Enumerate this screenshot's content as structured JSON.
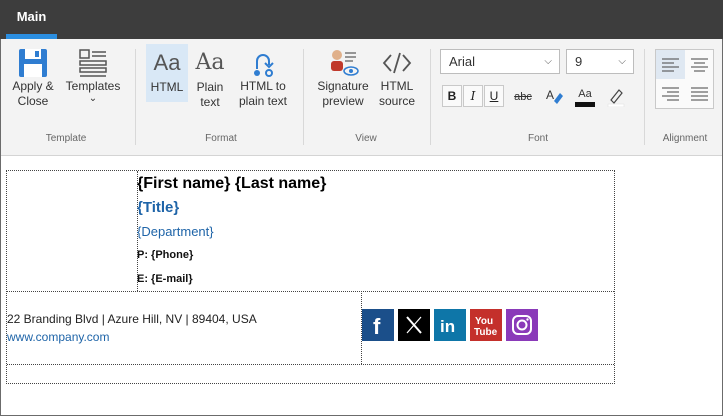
{
  "tabs": [
    {
      "label": "Main",
      "active": true
    }
  ],
  "ribbon": {
    "template_group": {
      "label": "Template",
      "buttons": [
        {
          "label_line1": "Apply &",
          "label_line2": "Close",
          "icon": "save-icon"
        },
        {
          "label_line1": "Templates",
          "label_line2": "⌄",
          "icon": "templates-icon"
        }
      ]
    },
    "format_group": {
      "label": "Format",
      "buttons": [
        {
          "label_line1": "HTML",
          "label_line2": "",
          "icon": "html-format-icon",
          "active": true
        },
        {
          "label_line1": "Plain",
          "label_line2": "text",
          "icon": "plain-text-icon"
        },
        {
          "label_line1": "HTML to",
          "label_line2": "plain text",
          "icon": "convert-icon"
        }
      ]
    },
    "view_group": {
      "label": "View",
      "buttons": [
        {
          "label_line1": "Signature",
          "label_line2": "preview",
          "icon": "signature-preview-icon"
        },
        {
          "label_line1": "HTML",
          "label_line2": "source",
          "icon": "code-icon"
        }
      ]
    },
    "font_group": {
      "label": "Font",
      "font_name": "Arial",
      "font_size": "9",
      "bold": "B",
      "italic": "I",
      "underline": "U",
      "strike": "abc",
      "font_color_label": "Aa"
    },
    "alignment_group": {
      "label": "Alignment"
    }
  },
  "signature": {
    "name": "{First name} {Last name}",
    "title": "{Title}",
    "department": "{Department}",
    "phone": "P: {Phone}",
    "email": "E: {E-mail}",
    "address": "22 Branding Blvd | Azure Hill, NV | 89404, USA",
    "website": "www.company.com",
    "social": [
      {
        "name": "facebook-icon",
        "glyph": "f",
        "color": "#1b4f8a"
      },
      {
        "name": "x-icon",
        "glyph": "𝕏",
        "color": "#000000"
      },
      {
        "name": "linkedin-icon",
        "glyph": "in",
        "color": "#0e76a8"
      },
      {
        "name": "youtube-icon",
        "glyph": "You Tube",
        "color": "#c4302b"
      },
      {
        "name": "instagram-icon",
        "glyph": "◎",
        "color": "#8a3ab9"
      }
    ]
  }
}
